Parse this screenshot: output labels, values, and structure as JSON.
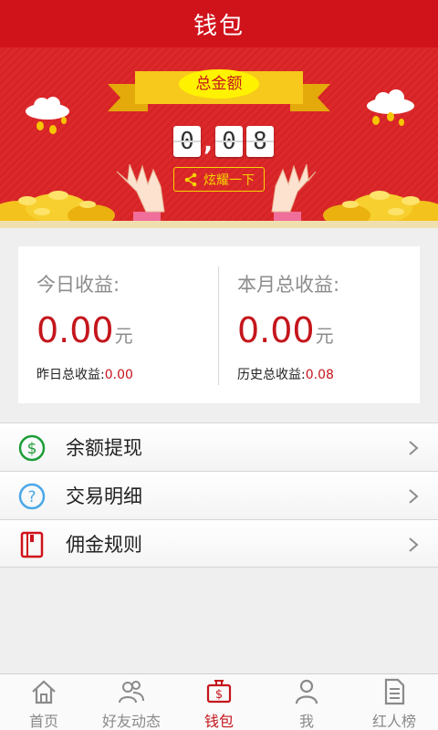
{
  "header": {
    "title": "钱包"
  },
  "banner": {
    "total_label": "总金额",
    "digits": [
      "0",
      ",",
      "0",
      "8"
    ],
    "share_label": "炫耀一下"
  },
  "stats": {
    "today": {
      "label": "今日收益:",
      "value": "0.00",
      "unit": "元",
      "sub_label": "昨日总收益:",
      "sub_value": "0.00"
    },
    "month": {
      "label": "本月总收益:",
      "value": "0.00",
      "unit": "元",
      "sub_label": "历史总收益:",
      "sub_value": "0.08"
    }
  },
  "menu": [
    {
      "label": "余额提现",
      "icon": "dollar-circle-icon"
    },
    {
      "label": "交易明细",
      "icon": "question-circle-icon"
    },
    {
      "label": "佣金规则",
      "icon": "book-icon"
    }
  ],
  "tabs": [
    {
      "label": "首页",
      "icon": "home-icon",
      "active": false
    },
    {
      "label": "好友动态",
      "icon": "friends-icon",
      "active": false
    },
    {
      "label": "钱包",
      "icon": "wallet-icon",
      "active": true
    },
    {
      "label": "我",
      "icon": "person-icon",
      "active": false
    },
    {
      "label": "红人榜",
      "icon": "document-icon",
      "active": false
    }
  ],
  "colors": {
    "brand_red": "#d0121b",
    "accent_red": "#c4161c",
    "gold": "#f6d500"
  }
}
